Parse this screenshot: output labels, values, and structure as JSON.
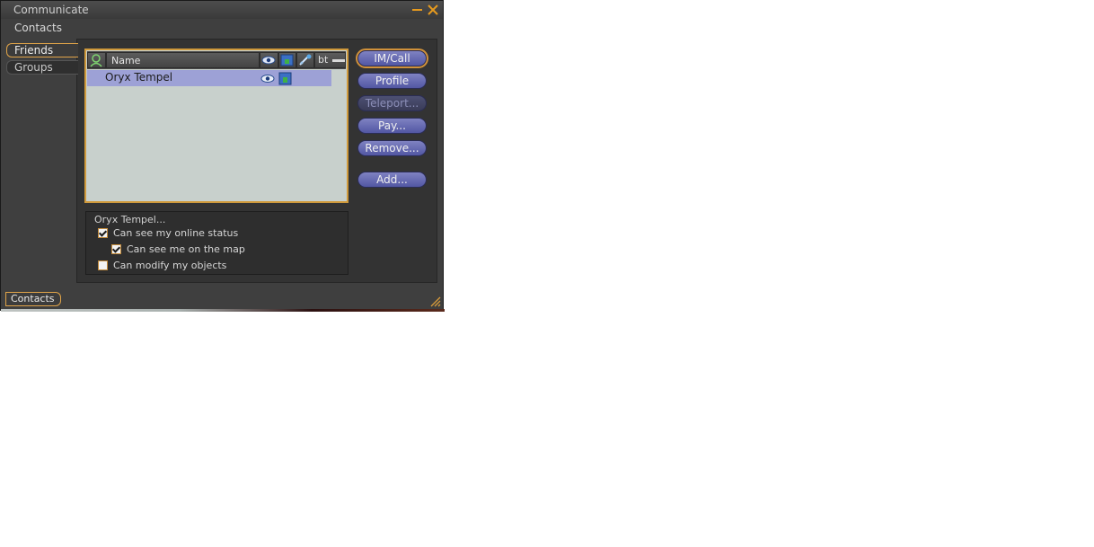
{
  "window": {
    "title": "Communicate",
    "subtitle": "Contacts"
  },
  "side_tabs": [
    {
      "label": "Friends",
      "active": true
    },
    {
      "label": "Groups",
      "active": false
    }
  ],
  "friends_list": {
    "columns": [
      {
        "label": "",
        "icon": "online-status-icon"
      },
      {
        "label": "Name"
      },
      {
        "label": "",
        "icon": "eye-icon"
      },
      {
        "label": "",
        "icon": "map-icon"
      },
      {
        "label": "",
        "icon": "edit-objects-icon"
      },
      {
        "label": "bt",
        "icon": "slider-icon"
      }
    ],
    "rows": [
      {
        "name": "Oryx Tempel",
        "can_see_online": true,
        "can_see_map": true
      }
    ]
  },
  "buttons": {
    "im_call": "IM/Call",
    "profile": "Profile",
    "teleport": "Teleport...",
    "pay": "Pay...",
    "remove": "Remove...",
    "add": "Add..."
  },
  "permissions": {
    "title": "Oryx Tempel...",
    "online_status": {
      "label": "Can see my online status",
      "checked": true
    },
    "see_on_map": {
      "label": "Can see me on the map",
      "checked": true
    },
    "modify_objects": {
      "label": "Can modify my objects",
      "checked": false
    }
  },
  "bottom_tab": "Contacts",
  "colors": {
    "accent": "#e0a449",
    "button": "#6a6eb8",
    "selected_row": "#9da1d6"
  }
}
